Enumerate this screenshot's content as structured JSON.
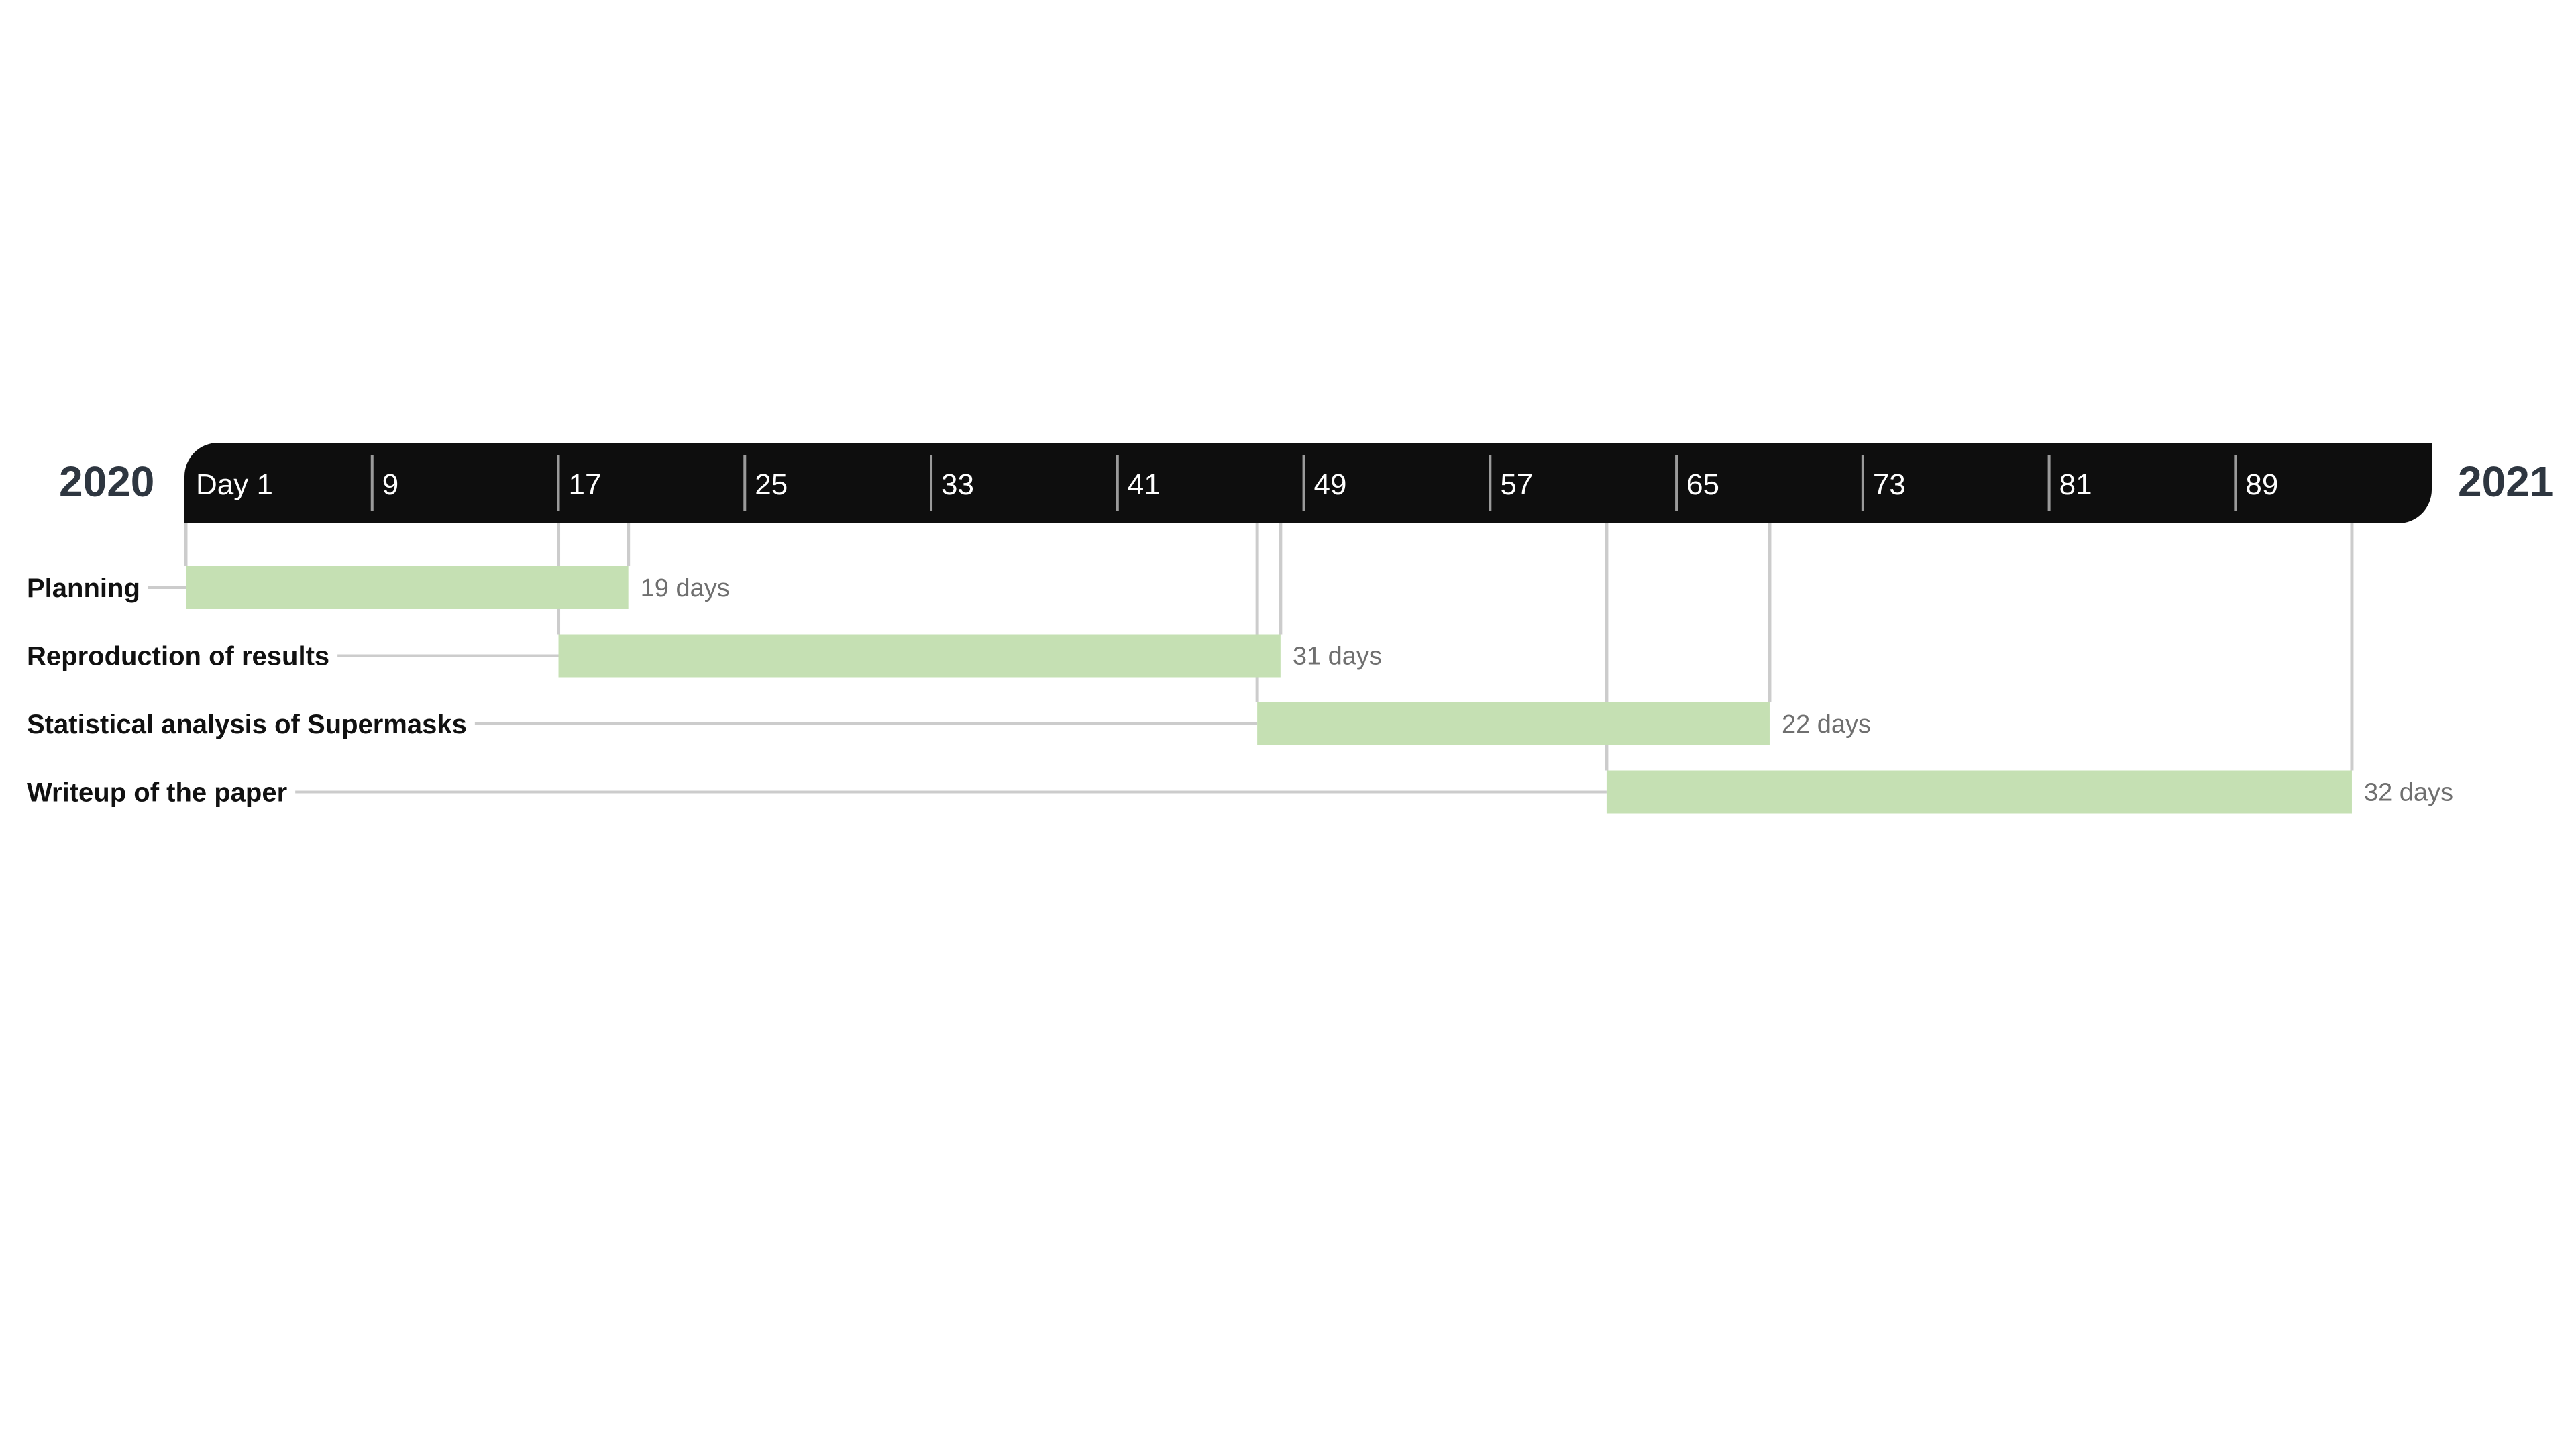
{
  "chart_data": {
    "type": "gantt",
    "start_year_label": "2020",
    "end_year_label": "2021",
    "first_tick_label": "Day 1",
    "ticks": [
      1,
      9,
      17,
      25,
      33,
      41,
      49,
      57,
      65,
      73,
      81,
      89
    ],
    "x_range": [
      1,
      97
    ],
    "tasks": [
      {
        "name": "Planning",
        "start_day": 1,
        "duration_days": 19,
        "duration_label": "19 days"
      },
      {
        "name": "Reproduction of results",
        "start_day": 17,
        "duration_days": 31,
        "duration_label": "31 days"
      },
      {
        "name": "Statistical analysis of Supermasks",
        "start_day": 47,
        "duration_days": 22,
        "duration_label": "22 days"
      },
      {
        "name": "Writeup of the paper",
        "start_day": 62,
        "duration_days": 32,
        "duration_label": "32 days"
      }
    ],
    "colors": {
      "header": "#0e0e0e",
      "bar": "#c5e0b3",
      "guide": "#cccccc",
      "year": "#2e3640"
    }
  }
}
